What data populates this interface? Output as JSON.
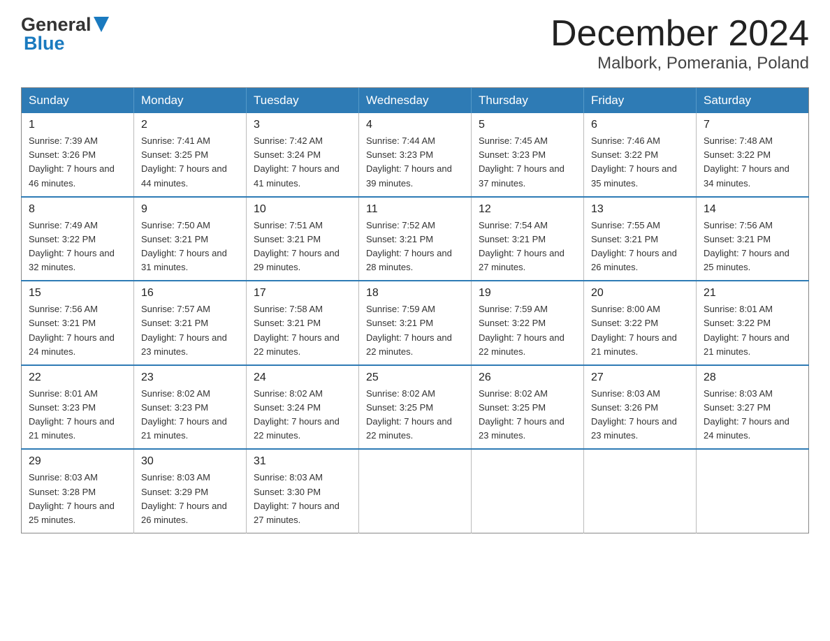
{
  "header": {
    "logo_general": "General",
    "logo_blue": "Blue",
    "month_title": "December 2024",
    "location": "Malbork, Pomerania, Poland"
  },
  "weekdays": [
    "Sunday",
    "Monday",
    "Tuesday",
    "Wednesday",
    "Thursday",
    "Friday",
    "Saturday"
  ],
  "weeks": [
    [
      {
        "day": "1",
        "sunrise": "Sunrise: 7:39 AM",
        "sunset": "Sunset: 3:26 PM",
        "daylight": "Daylight: 7 hours and 46 minutes."
      },
      {
        "day": "2",
        "sunrise": "Sunrise: 7:41 AM",
        "sunset": "Sunset: 3:25 PM",
        "daylight": "Daylight: 7 hours and 44 minutes."
      },
      {
        "day": "3",
        "sunrise": "Sunrise: 7:42 AM",
        "sunset": "Sunset: 3:24 PM",
        "daylight": "Daylight: 7 hours and 41 minutes."
      },
      {
        "day": "4",
        "sunrise": "Sunrise: 7:44 AM",
        "sunset": "Sunset: 3:23 PM",
        "daylight": "Daylight: 7 hours and 39 minutes."
      },
      {
        "day": "5",
        "sunrise": "Sunrise: 7:45 AM",
        "sunset": "Sunset: 3:23 PM",
        "daylight": "Daylight: 7 hours and 37 minutes."
      },
      {
        "day": "6",
        "sunrise": "Sunrise: 7:46 AM",
        "sunset": "Sunset: 3:22 PM",
        "daylight": "Daylight: 7 hours and 35 minutes."
      },
      {
        "day": "7",
        "sunrise": "Sunrise: 7:48 AM",
        "sunset": "Sunset: 3:22 PM",
        "daylight": "Daylight: 7 hours and 34 minutes."
      }
    ],
    [
      {
        "day": "8",
        "sunrise": "Sunrise: 7:49 AM",
        "sunset": "Sunset: 3:22 PM",
        "daylight": "Daylight: 7 hours and 32 minutes."
      },
      {
        "day": "9",
        "sunrise": "Sunrise: 7:50 AM",
        "sunset": "Sunset: 3:21 PM",
        "daylight": "Daylight: 7 hours and 31 minutes."
      },
      {
        "day": "10",
        "sunrise": "Sunrise: 7:51 AM",
        "sunset": "Sunset: 3:21 PM",
        "daylight": "Daylight: 7 hours and 29 minutes."
      },
      {
        "day": "11",
        "sunrise": "Sunrise: 7:52 AM",
        "sunset": "Sunset: 3:21 PM",
        "daylight": "Daylight: 7 hours and 28 minutes."
      },
      {
        "day": "12",
        "sunrise": "Sunrise: 7:54 AM",
        "sunset": "Sunset: 3:21 PM",
        "daylight": "Daylight: 7 hours and 27 minutes."
      },
      {
        "day": "13",
        "sunrise": "Sunrise: 7:55 AM",
        "sunset": "Sunset: 3:21 PM",
        "daylight": "Daylight: 7 hours and 26 minutes."
      },
      {
        "day": "14",
        "sunrise": "Sunrise: 7:56 AM",
        "sunset": "Sunset: 3:21 PM",
        "daylight": "Daylight: 7 hours and 25 minutes."
      }
    ],
    [
      {
        "day": "15",
        "sunrise": "Sunrise: 7:56 AM",
        "sunset": "Sunset: 3:21 PM",
        "daylight": "Daylight: 7 hours and 24 minutes."
      },
      {
        "day": "16",
        "sunrise": "Sunrise: 7:57 AM",
        "sunset": "Sunset: 3:21 PM",
        "daylight": "Daylight: 7 hours and 23 minutes."
      },
      {
        "day": "17",
        "sunrise": "Sunrise: 7:58 AM",
        "sunset": "Sunset: 3:21 PM",
        "daylight": "Daylight: 7 hours and 22 minutes."
      },
      {
        "day": "18",
        "sunrise": "Sunrise: 7:59 AM",
        "sunset": "Sunset: 3:21 PM",
        "daylight": "Daylight: 7 hours and 22 minutes."
      },
      {
        "day": "19",
        "sunrise": "Sunrise: 7:59 AM",
        "sunset": "Sunset: 3:22 PM",
        "daylight": "Daylight: 7 hours and 22 minutes."
      },
      {
        "day": "20",
        "sunrise": "Sunrise: 8:00 AM",
        "sunset": "Sunset: 3:22 PM",
        "daylight": "Daylight: 7 hours and 21 minutes."
      },
      {
        "day": "21",
        "sunrise": "Sunrise: 8:01 AM",
        "sunset": "Sunset: 3:22 PM",
        "daylight": "Daylight: 7 hours and 21 minutes."
      }
    ],
    [
      {
        "day": "22",
        "sunrise": "Sunrise: 8:01 AM",
        "sunset": "Sunset: 3:23 PM",
        "daylight": "Daylight: 7 hours and 21 minutes."
      },
      {
        "day": "23",
        "sunrise": "Sunrise: 8:02 AM",
        "sunset": "Sunset: 3:23 PM",
        "daylight": "Daylight: 7 hours and 21 minutes."
      },
      {
        "day": "24",
        "sunrise": "Sunrise: 8:02 AM",
        "sunset": "Sunset: 3:24 PM",
        "daylight": "Daylight: 7 hours and 22 minutes."
      },
      {
        "day": "25",
        "sunrise": "Sunrise: 8:02 AM",
        "sunset": "Sunset: 3:25 PM",
        "daylight": "Daylight: 7 hours and 22 minutes."
      },
      {
        "day": "26",
        "sunrise": "Sunrise: 8:02 AM",
        "sunset": "Sunset: 3:25 PM",
        "daylight": "Daylight: 7 hours and 23 minutes."
      },
      {
        "day": "27",
        "sunrise": "Sunrise: 8:03 AM",
        "sunset": "Sunset: 3:26 PM",
        "daylight": "Daylight: 7 hours and 23 minutes."
      },
      {
        "day": "28",
        "sunrise": "Sunrise: 8:03 AM",
        "sunset": "Sunset: 3:27 PM",
        "daylight": "Daylight: 7 hours and 24 minutes."
      }
    ],
    [
      {
        "day": "29",
        "sunrise": "Sunrise: 8:03 AM",
        "sunset": "Sunset: 3:28 PM",
        "daylight": "Daylight: 7 hours and 25 minutes."
      },
      {
        "day": "30",
        "sunrise": "Sunrise: 8:03 AM",
        "sunset": "Sunset: 3:29 PM",
        "daylight": "Daylight: 7 hours and 26 minutes."
      },
      {
        "day": "31",
        "sunrise": "Sunrise: 8:03 AM",
        "sunset": "Sunset: 3:30 PM",
        "daylight": "Daylight: 7 hours and 27 minutes."
      },
      null,
      null,
      null,
      null
    ]
  ]
}
